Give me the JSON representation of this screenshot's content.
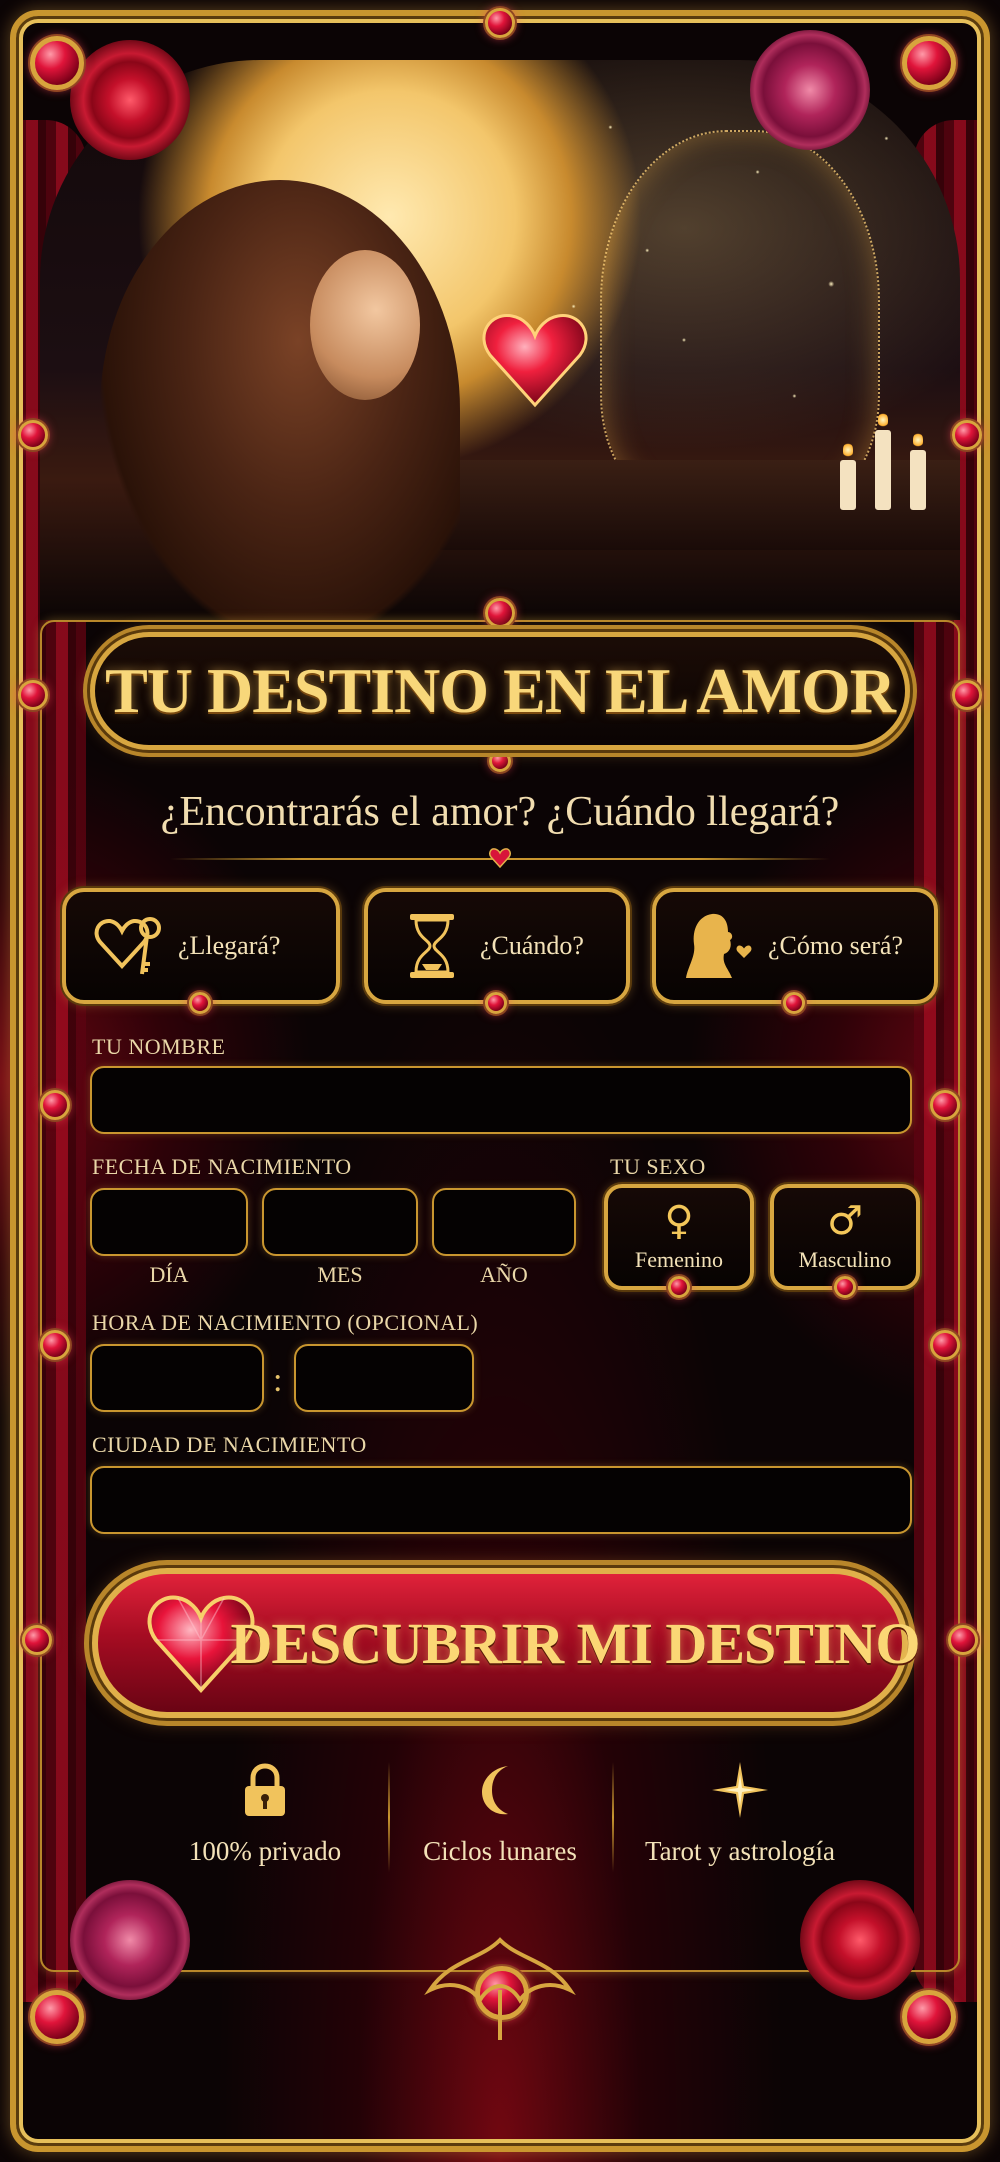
{
  "colors": {
    "gold": "#e0b04a",
    "ruby": "#d8143a",
    "background": "#0b0405"
  },
  "header": {
    "title": "TU DESTINO EN EL AMOR",
    "subtitle": "¿Encontrarás el amor? ¿Cuándo llegará?"
  },
  "options": [
    {
      "label": "¿Llegará?",
      "icon": "heart-key-icon"
    },
    {
      "label": "¿Cuándo?",
      "icon": "hourglass-icon"
    },
    {
      "label": "¿Cómo será?",
      "icon": "woman-silhouette-icon"
    }
  ],
  "form": {
    "name_label": "TU NOMBRE",
    "name_value": "",
    "birthdate_label": "FECHA DE NACIMIENTO",
    "day_label": "DÍA",
    "month_label": "MES",
    "year_label": "AÑO",
    "sex_label": "TU SEXO",
    "sex_options": [
      {
        "label": "Femenino",
        "symbol": "♀"
      },
      {
        "label": "Masculino",
        "symbol": "♂"
      }
    ],
    "time_label": "HORA DE NACIMIENTO (OPCIONAL)",
    "time_separator": ":",
    "city_label": "CIUDAD DE NACIMIENTO"
  },
  "cta": {
    "label": "DESCUBRIR MI DESTINO"
  },
  "features": [
    {
      "label": "100% privado",
      "icon": "lock-icon"
    },
    {
      "label": "Ciclos lunares",
      "icon": "crescent-moon-icon"
    },
    {
      "label": "Tarot y astrología",
      "icon": "star-icon"
    }
  ]
}
